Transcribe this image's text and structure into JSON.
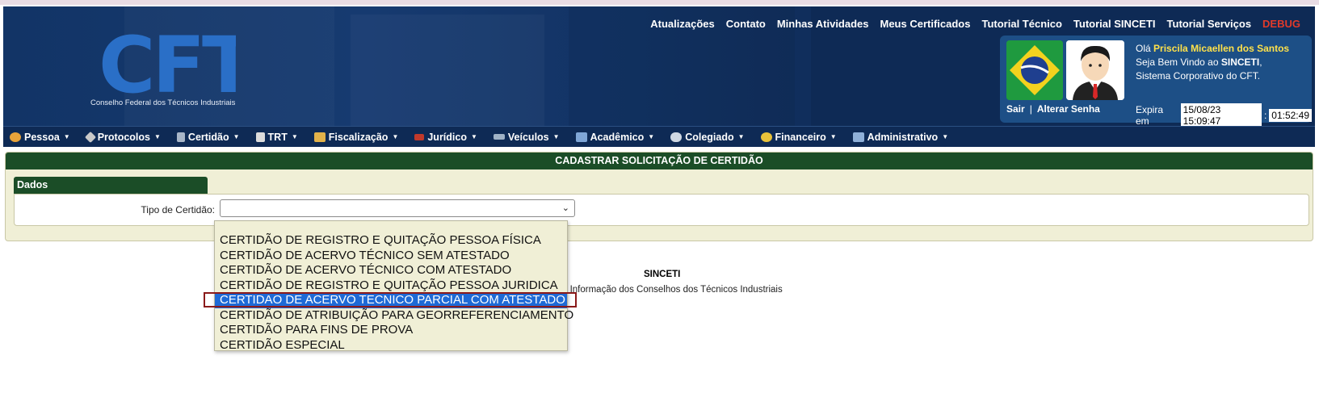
{
  "header": {
    "logo_text": "CFT",
    "logo_subtitle": "Conselho Federal dos Técnicos Industriais",
    "top_nav": [
      "Atualizações",
      "Contato",
      "Minhas Atividades",
      "Meus Certificados",
      "Tutorial Técnico",
      "Tutorial SINCETI",
      "Tutorial Serviços"
    ],
    "debug_label": "DEBUG"
  },
  "user": {
    "greeting": "Olá",
    "name": "Priscila Micaellen dos Santos",
    "welcome_prefix": "Seja Bem Vindo ao ",
    "system": "SINCETI",
    "welcome_suffix": ",",
    "system_desc": "Sistema Corporativo do CFT.",
    "logout": "Sair",
    "separator": "|",
    "change_password": "Alterar Senha",
    "expires_label": "Expira em",
    "expires_datetime": "15/08/23 15:09:47",
    "colon": ":",
    "countdown": "01:52:49"
  },
  "menu": [
    {
      "label": "Pessoa",
      "icon": "people-icon",
      "color": "#e8a33a"
    },
    {
      "label": "Protocolos",
      "icon": "tag-icon",
      "color": "#c9c9c9"
    },
    {
      "label": "Certidão",
      "icon": "document-icon",
      "color": "#a8b6c8"
    },
    {
      "label": "TRT",
      "icon": "copy-icon",
      "color": "#dcdcdc"
    },
    {
      "label": "Fiscalização",
      "icon": "box-icon",
      "color": "#e2b24a"
    },
    {
      "label": "Jurídico",
      "icon": "gavel-icon",
      "color": "#c0392b"
    },
    {
      "label": "Veículos",
      "icon": "car-icon",
      "color": "#9fb2c6"
    },
    {
      "label": "Acadêmico",
      "icon": "book-icon",
      "color": "#7fa6d6"
    },
    {
      "label": "Colegiado",
      "icon": "chat-icon",
      "color": "#cfd8e3"
    },
    {
      "label": "Financeiro",
      "icon": "coins-icon",
      "color": "#e8c23a"
    },
    {
      "label": "Administrativo",
      "icon": "admin-icon",
      "color": "#8fb0d8"
    }
  ],
  "panel": {
    "title": "CADASTRAR SOLICITAÇÃO DE CERTIDÃO",
    "section": "Dados",
    "field_label": "Tipo de Certidão:",
    "field_value": ""
  },
  "dropdown_options": [
    "CERTIDÃO DE REGISTRO E QUITAÇÃO PESSOA FÍSICA",
    "CERTIDÃO DE ACERVO TÉCNICO SEM ATESTADO",
    "CERTIDÃO DE ACERVO TÉCNICO COM ATESTADO",
    "CERTIDÃO DE REGISTRO E QUITAÇÃO PESSOA JURIDICA",
    "CERTIDAO DE ACERVO TECNICO PARCIAL COM ATESTADO",
    "CERTIDÃO DE ATRIBUIÇÃO PARA GEORREFERENCIAMENTO",
    "CERTIDÃO PARA FINS DE PROVA",
    "CERTIDÃO ESPECIAL"
  ],
  "selected_index": 4,
  "footer": {
    "title": "SINCETI",
    "subtitle": "e Informação dos Conselhos dos Técnicos Industriais"
  }
}
